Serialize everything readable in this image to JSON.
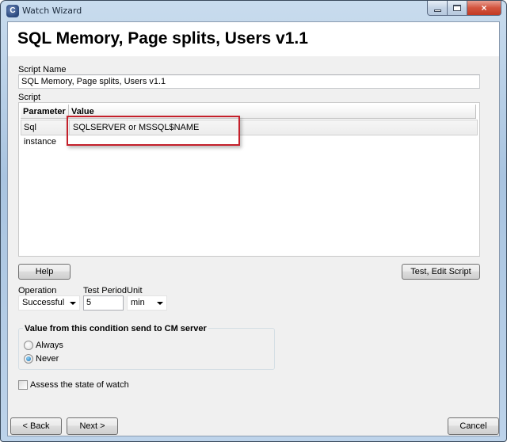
{
  "window": {
    "title": "Watch Wizard",
    "icon": "app-c-icon",
    "controls": {
      "minimize": "minimize-icon",
      "maximize": "maximize-icon",
      "close": "×"
    }
  },
  "header": {
    "title": "SQL Memory, Page splits, Users v1.1"
  },
  "script_name": {
    "label": "Script Name",
    "value": "SQL Memory, Page splits, Users v1.1"
  },
  "script": {
    "label": "Script",
    "columns": [
      "Parameter",
      "Value"
    ],
    "rows": [
      {
        "parameter": "Sql instance",
        "value": "SQLSERVER or MSSQL$NAME"
      }
    ],
    "highlight_color": "#c4202b"
  },
  "buttons": {
    "help": "Help",
    "test_edit_script": "Test, Edit Script",
    "back": "< Back",
    "next": "Next >",
    "cancel": "Cancel"
  },
  "operation": {
    "label": "Operation",
    "selected": "Successful"
  },
  "test_period": {
    "label": "Test Period",
    "value": "5"
  },
  "unit": {
    "label": "Unit",
    "selected": "min"
  },
  "send_group": {
    "title": "Value from this condition send to CM server",
    "options": [
      {
        "label": "Always",
        "checked": false
      },
      {
        "label": "Never",
        "checked": true
      }
    ]
  },
  "assess": {
    "label": "Assess the state of watch",
    "checked": false
  }
}
